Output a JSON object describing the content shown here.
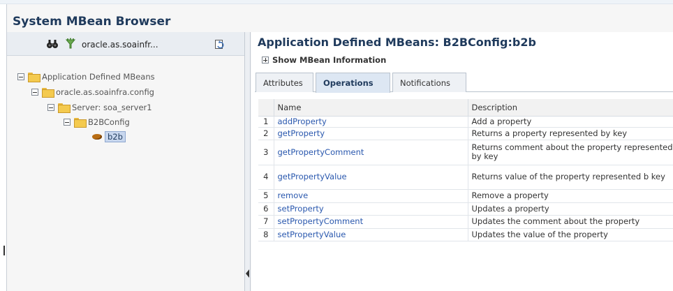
{
  "app": {
    "title": "System MBean Browser"
  },
  "toolbar": {
    "find_icon": "binoculars-icon",
    "filter_icon": "filter-icon",
    "path_text": "oracle.as.soainfr...",
    "refresh_icon": "refresh-icon"
  },
  "tree": [
    {
      "label": "Application Defined MBeans",
      "icon": "folder-icon"
    },
    {
      "label": "oracle.as.soainfra.config",
      "icon": "folder-icon"
    },
    {
      "label": "Server: soa_server1",
      "icon": "folder-icon"
    },
    {
      "label": "B2BConfig",
      "icon": "folder-icon"
    },
    {
      "label": "b2b",
      "icon": "bean-icon",
      "selected": true
    }
  ],
  "main": {
    "title": "Application Defined MBeans: B2BConfig:b2b",
    "show_info": "Show MBean Information",
    "tabs": [
      {
        "label": "Attributes",
        "active": false
      },
      {
        "label": "Operations",
        "active": true
      },
      {
        "label": "Notifications",
        "active": false
      }
    ],
    "table": {
      "headers": [
        "",
        "Name",
        "Description"
      ],
      "rows": [
        {
          "num": "1",
          "name": "addProperty",
          "desc": "Add a property"
        },
        {
          "num": "2",
          "name": "getProperty",
          "desc": "Returns a property represented by key"
        },
        {
          "num": "3",
          "name": "getPropertyComment",
          "desc": "Returns comment about the property represented by key"
        },
        {
          "num": "4",
          "name": "getPropertyValue",
          "desc": "Returns value of the property represented b key"
        },
        {
          "num": "5",
          "name": "remove",
          "desc": "Remove a property"
        },
        {
          "num": "6",
          "name": "setProperty",
          "desc": "Updates a property"
        },
        {
          "num": "7",
          "name": "setPropertyComment",
          "desc": "Updates the comment about the property"
        },
        {
          "num": "8",
          "name": "setPropertyValue",
          "desc": "Updates the value of the property"
        }
      ]
    }
  },
  "colors": {
    "title_blue": "#1f3a5c",
    "link_blue": "#2a58ae",
    "selected_bg": "#c8d7ee",
    "folder_yellow": "#f4ca4f"
  }
}
